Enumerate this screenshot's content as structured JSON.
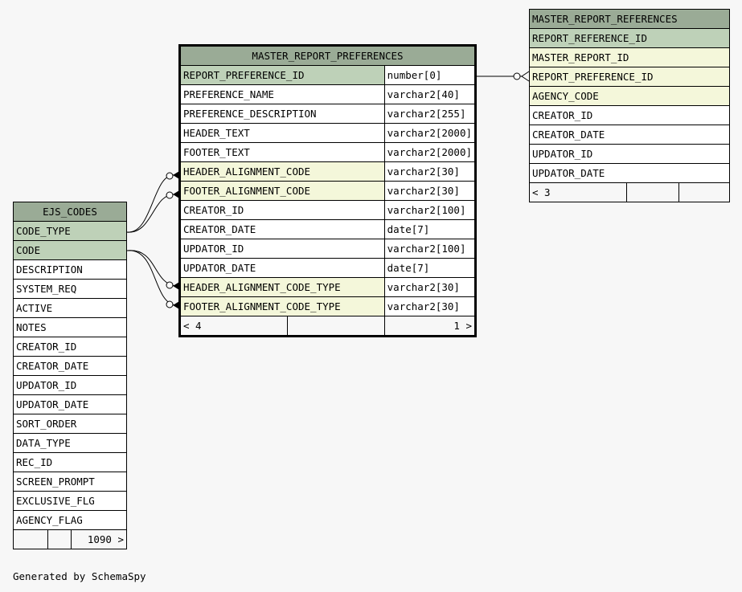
{
  "ejs_codes": {
    "name": "EJS_CODES",
    "columns": [
      {
        "name": "CODE_TYPE",
        "key": "pk"
      },
      {
        "name": "CODE",
        "key": "pk"
      },
      {
        "name": "DESCRIPTION",
        "key": ""
      },
      {
        "name": "SYSTEM_REQ",
        "key": ""
      },
      {
        "name": "ACTIVE",
        "key": ""
      },
      {
        "name": "NOTES",
        "key": ""
      },
      {
        "name": "CREATOR_ID",
        "key": ""
      },
      {
        "name": "CREATOR_DATE",
        "key": ""
      },
      {
        "name": "UPDATOR_ID",
        "key": ""
      },
      {
        "name": "UPDATOR_DATE",
        "key": ""
      },
      {
        "name": "SORT_ORDER",
        "key": ""
      },
      {
        "name": "DATA_TYPE",
        "key": ""
      },
      {
        "name": "REC_ID",
        "key": ""
      },
      {
        "name": "SCREEN_PROMPT",
        "key": ""
      },
      {
        "name": "EXCLUSIVE_FLG",
        "key": ""
      },
      {
        "name": "AGENCY_FLAG",
        "key": ""
      }
    ],
    "footer_rows": "1090 >"
  },
  "master_report_preferences": {
    "name": "MASTER_REPORT_PREFERENCES",
    "columns": [
      {
        "name": "REPORT_PREFERENCE_ID",
        "type": "number[0]",
        "key": "pk"
      },
      {
        "name": "PREFERENCE_NAME",
        "type": "varchar2[40]",
        "key": ""
      },
      {
        "name": "PREFERENCE_DESCRIPTION",
        "type": "varchar2[255]",
        "key": ""
      },
      {
        "name": "HEADER_TEXT",
        "type": "varchar2[2000]",
        "key": ""
      },
      {
        "name": "FOOTER_TEXT",
        "type": "varchar2[2000]",
        "key": ""
      },
      {
        "name": "HEADER_ALIGNMENT_CODE",
        "type": "varchar2[30]",
        "key": "fk"
      },
      {
        "name": "FOOTER_ALIGNMENT_CODE",
        "type": "varchar2[30]",
        "key": "fk"
      },
      {
        "name": "CREATOR_ID",
        "type": "varchar2[100]",
        "key": ""
      },
      {
        "name": "CREATOR_DATE",
        "type": "date[7]",
        "key": ""
      },
      {
        "name": "UPDATOR_ID",
        "type": "varchar2[100]",
        "key": ""
      },
      {
        "name": "UPDATOR_DATE",
        "type": "date[7]",
        "key": ""
      },
      {
        "name": "HEADER_ALIGNMENT_CODE_TYPE",
        "type": "varchar2[30]",
        "key": "fk"
      },
      {
        "name": "FOOTER_ALIGNMENT_CODE_TYPE",
        "type": "varchar2[30]",
        "key": "fk"
      }
    ],
    "footer_parents": "< 4",
    "footer_children": "1 >"
  },
  "master_report_references": {
    "name": "MASTER_REPORT_REFERENCES",
    "columns": [
      {
        "name": "REPORT_REFERENCE_ID",
        "key": "pk"
      },
      {
        "name": "MASTER_REPORT_ID",
        "key": "fk"
      },
      {
        "name": "REPORT_PREFERENCE_ID",
        "key": "fk"
      },
      {
        "name": "AGENCY_CODE",
        "key": "fk"
      },
      {
        "name": "CREATOR_ID",
        "key": ""
      },
      {
        "name": "CREATOR_DATE",
        "key": ""
      },
      {
        "name": "UPDATOR_ID",
        "key": ""
      },
      {
        "name": "UPDATOR_DATE",
        "key": ""
      }
    ],
    "footer_parents": "< 3"
  },
  "caption": "Generated by SchemaSpy"
}
